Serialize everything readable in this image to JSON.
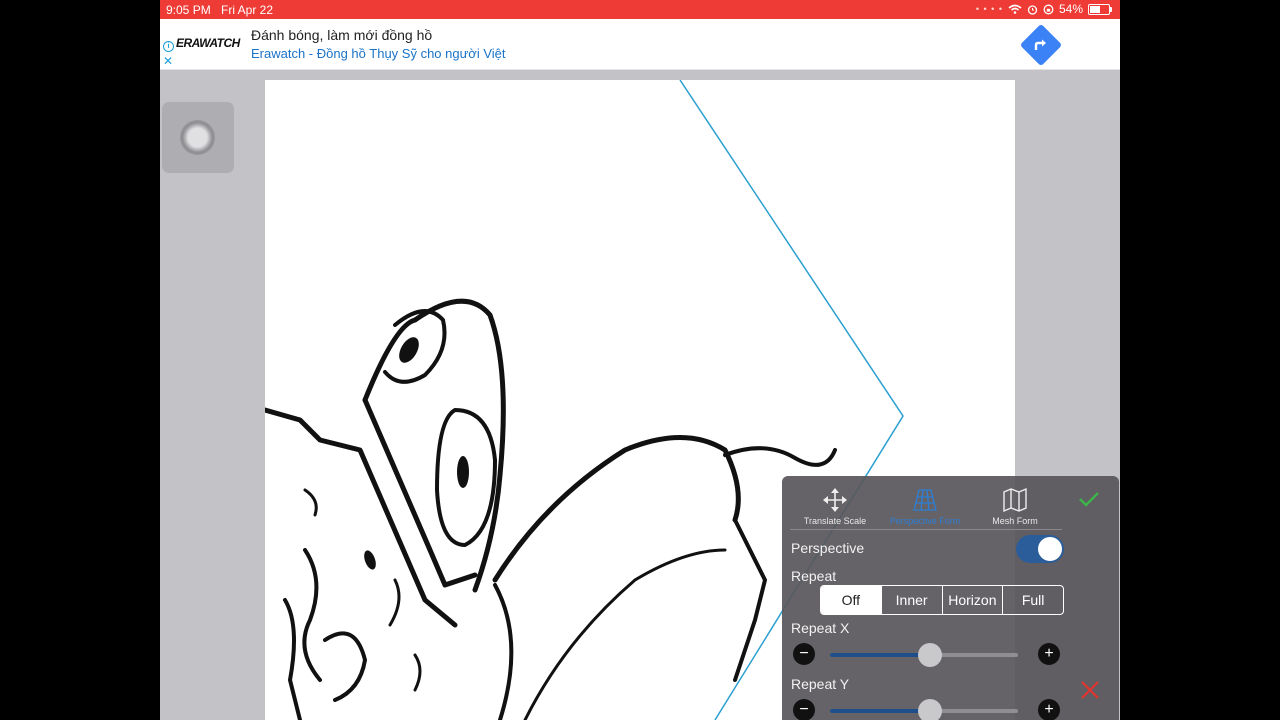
{
  "status_bar": {
    "time": "9:05 PM",
    "date": "Fri Apr 22",
    "battery": "54%",
    "battery_level": 0.54
  },
  "ad": {
    "logo": "ERAWATCH",
    "title": "Đánh bóng, làm mới đồng hồ",
    "subtitle": "Erawatch - Đồng hồ Thụy Sỹ cho người Việt",
    "info_icon": "info-icon",
    "close_icon": "close-icon",
    "cta_icon": "directions-arrow-icon"
  },
  "transform_panel": {
    "tools": [
      {
        "label": "Translate Scale",
        "icon": "move-arrows-icon",
        "active": false
      },
      {
        "label": "Perspective Form",
        "icon": "perspective-grid-icon",
        "active": true
      },
      {
        "label": "Mesh Form",
        "icon": "map-fold-icon",
        "active": false
      }
    ],
    "perspective_label": "Perspective",
    "perspective_on": true,
    "repeat_label": "Repeat",
    "repeat_options": [
      "Off",
      "Inner",
      "Horizon",
      "Full"
    ],
    "repeat_selected": "Off",
    "repeat_x_label": "Repeat X",
    "repeat_x_value": 0.53,
    "repeat_y_label": "Repeat Y",
    "repeat_y_value": 0.53,
    "minus_symbol": "−",
    "plus_symbol": "+"
  },
  "colors": {
    "status_bar": "#ee3b35",
    "accent": "#2e7fd6",
    "confirm": "#3cb54a",
    "cancel": "#e0342f",
    "guide_line": "#2a9fd0"
  }
}
